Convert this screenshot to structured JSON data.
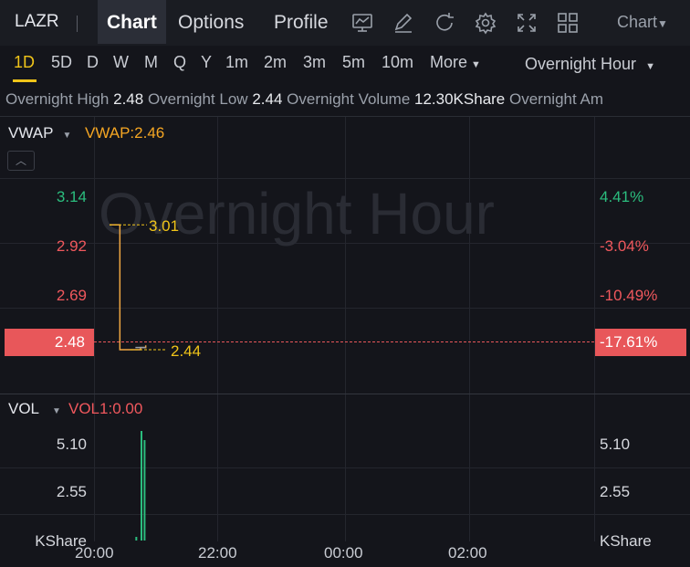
{
  "toolbar": {
    "ticker": "LAZR",
    "tabs": [
      "Chart",
      "Options",
      "Profile"
    ],
    "chart_menu": "Chart",
    "icons": [
      "indicator-icon",
      "draw-icon",
      "refresh-icon",
      "settings-icon",
      "fullscreen-icon",
      "layout-icon"
    ]
  },
  "periods": {
    "items": [
      "1D",
      "5D",
      "D",
      "W",
      "M",
      "Q",
      "Y",
      "1m",
      "2m",
      "3m",
      "5m",
      "10m"
    ],
    "more": "More",
    "active": "1D",
    "session": "Overnight Hour"
  },
  "stats": {
    "high_label": "Overnight High",
    "high": "2.48",
    "low_label": "Overnight Low",
    "low": "2.44",
    "volume_label": "Overnight Volume",
    "volume": "12.30KShare",
    "amount_label": "Overnight Am"
  },
  "price_panel": {
    "indicator": "VWAP",
    "indicator_value": "VWAP:2.46",
    "watermark": "Overnight Hour",
    "y_ticks": [
      "3.14",
      "2.92",
      "2.69"
    ],
    "pct_ticks": [
      "4.41%",
      "-3.04%",
      "-10.49%"
    ],
    "current_price": "2.48",
    "current_pct": "-17.61%",
    "high_marker": "3.01",
    "low_marker": "2.44"
  },
  "volume_panel": {
    "indicator": "VOL",
    "indicator_value": "VOL1:0.00",
    "y_ticks": [
      "5.10",
      "2.55"
    ],
    "unit": "KShare"
  },
  "x_axis": [
    "20:00",
    "22:00",
    "00:00",
    "02:00"
  ],
  "colors": {
    "up": "#2bbd7e",
    "down": "#f0585d",
    "accent": "#f0c419",
    "vwap": "#f5a623",
    "price_line": "#f0a742"
  },
  "chart_data": {
    "type": "line",
    "x": [
      "20:00",
      "20:05",
      "20:10",
      "20:20",
      "20:30",
      "20:35"
    ],
    "series": [
      {
        "name": "VWAP",
        "values": [
          3.01,
          3.01,
          2.44,
          2.44,
          2.45,
          2.46
        ]
      }
    ],
    "ylim": [
      2.4,
      3.2
    ],
    "volume": {
      "x": [
        "20:25",
        "20:30",
        "20:33"
      ],
      "values": [
        0.2,
        6.0,
        5.5
      ],
      "ylim": [
        0,
        6.5
      ]
    }
  }
}
